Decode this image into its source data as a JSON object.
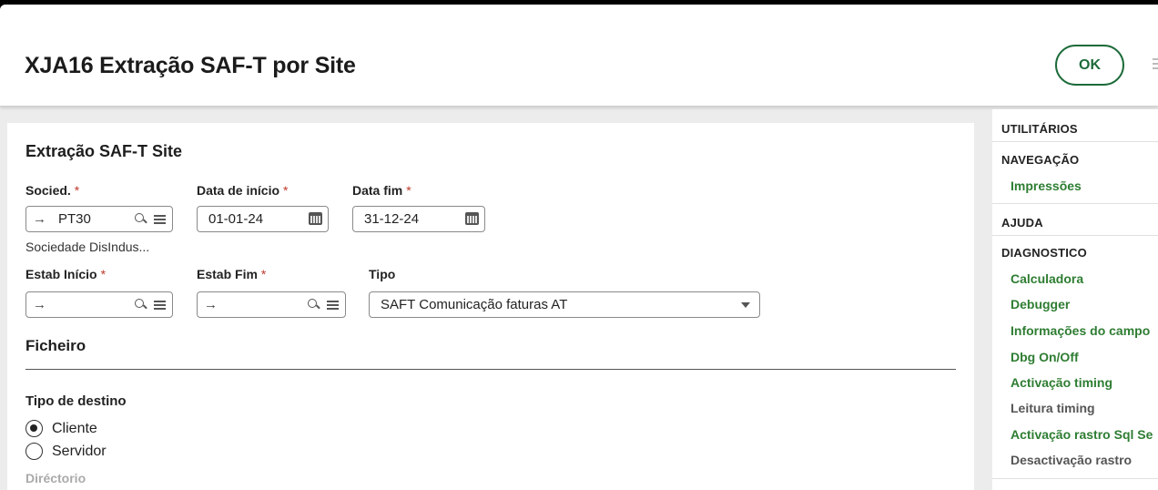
{
  "header": {
    "title": "XJA16 Extração SAF-T por Site",
    "ok_label": "OK"
  },
  "form": {
    "section_title": "Extração SAF-T Site",
    "socied": {
      "label": "Socied.",
      "required_mark": "*",
      "value": "PT30",
      "description": "Sociedade DisIndus..."
    },
    "data_inicio": {
      "label": "Data de início",
      "required_mark": "*",
      "value": "01-01-24"
    },
    "data_fim": {
      "label": "Data fim",
      "required_mark": "*",
      "value": "31-12-24"
    },
    "estab_inicio": {
      "label": "Estab Início",
      "required_mark": "*",
      "value": ""
    },
    "estab_fim": {
      "label": "Estab Fim",
      "required_mark": "*",
      "value": ""
    },
    "tipo": {
      "label": "Tipo",
      "value": "SAFT Comunicação faturas AT"
    },
    "ficheiro": {
      "title": "Ficheiro",
      "tipo_destino_label": "Tipo de destino",
      "options": [
        {
          "label": "Cliente",
          "selected": true
        },
        {
          "label": "Servidor",
          "selected": false
        }
      ],
      "directorio_label": "Diréctorio"
    }
  },
  "right_panel": {
    "utilitarios": "UTILITÁRIOS",
    "navegacao": "NAVEGAÇÃO",
    "navegacao_items": [
      "Impressões"
    ],
    "ajuda": "AJUDA",
    "diagnostico": "DIAGNOSTICO",
    "diagnostico_items": [
      {
        "label": "Calculadora",
        "enabled": true
      },
      {
        "label": "Debugger",
        "enabled": true
      },
      {
        "label": "Informações do campo",
        "enabled": true
      },
      {
        "label": "Dbg On/Off",
        "enabled": true
      },
      {
        "label": "Activação timing",
        "enabled": true
      },
      {
        "label": "Leitura timing",
        "enabled": false
      },
      {
        "label": "Activação rastro Sql Se",
        "enabled": true
      },
      {
        "label": "Desactivação rastro",
        "enabled": false
      }
    ]
  },
  "colors": {
    "accent": "#2e7d32",
    "required": "#c0392b",
    "disabled_link": "#555555"
  }
}
